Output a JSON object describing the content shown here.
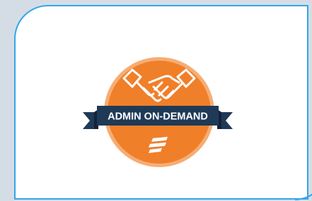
{
  "badge": {
    "ribbon_text": "ADMIN ON-DEMAND",
    "icon_top": "handshake-icon",
    "icon_bottom": "brand-logo-icon"
  },
  "colors": {
    "background": "#d4dde5",
    "card": "#ffffff",
    "card_border": "#33a6e8",
    "badge_fill": "#f07f2a",
    "badge_ring": "#f6ad74",
    "ribbon": "#1f3a57",
    "ribbon_shadow": "#12243a",
    "icon": "#ffffff"
  }
}
